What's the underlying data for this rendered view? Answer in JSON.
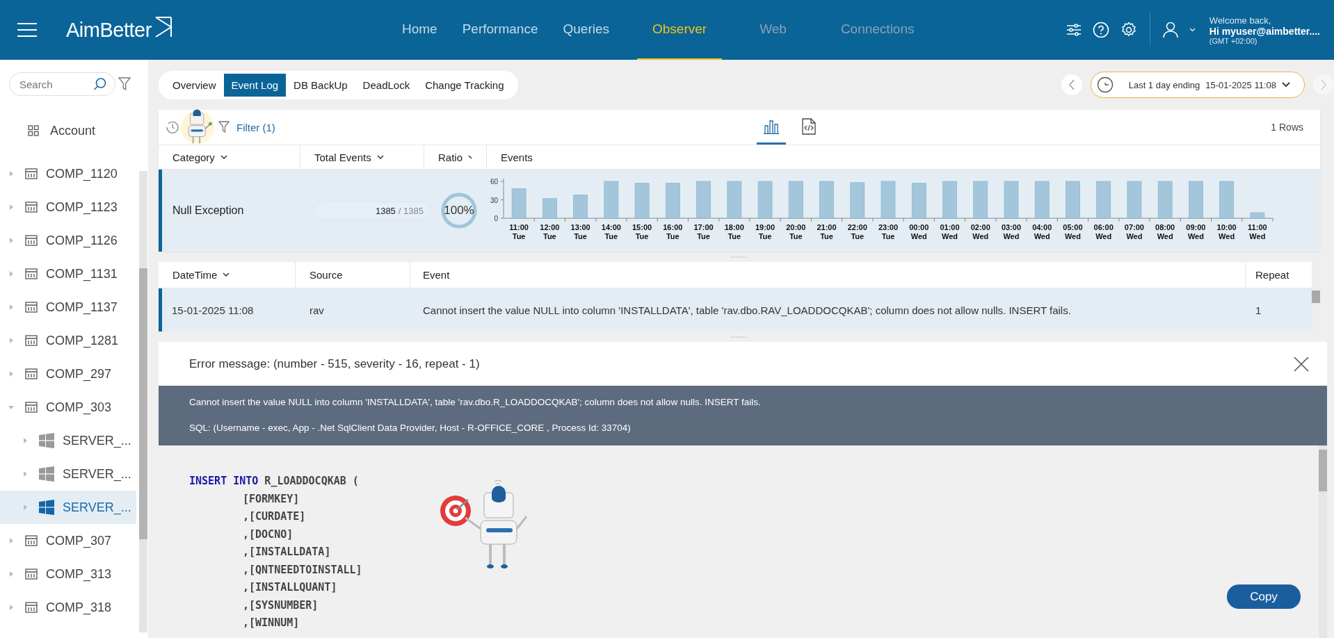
{
  "header": {
    "logo": "AimBetter",
    "nav": [
      {
        "label": "Home",
        "selected": false,
        "disabled": false
      },
      {
        "label": "Performance",
        "selected": false,
        "disabled": false
      },
      {
        "label": "Queries",
        "selected": false,
        "disabled": false
      },
      {
        "label": "Observer",
        "selected": true,
        "disabled": false
      },
      {
        "label": "Web",
        "selected": false,
        "disabled": true
      },
      {
        "label": "Connections",
        "selected": false,
        "disabled": true
      }
    ],
    "user": {
      "greeting": "Welcome back,",
      "name": "Hi myuser@aimbetter....",
      "timezone": "(GMT +02:00)"
    }
  },
  "sidebar": {
    "search": {
      "placeholder": "Search"
    },
    "account": "Account",
    "items": [
      {
        "label": "COMP_1120",
        "expanded": false,
        "selected": false
      },
      {
        "label": "COMP_1123",
        "expanded": false,
        "selected": false
      },
      {
        "label": "COMP_1126",
        "expanded": false,
        "selected": false
      },
      {
        "label": "COMP_1131",
        "expanded": false,
        "selected": false
      },
      {
        "label": "COMP_1137",
        "expanded": false,
        "selected": false
      },
      {
        "label": "COMP_1281",
        "expanded": false,
        "selected": false
      },
      {
        "label": "COMP_297",
        "expanded": false,
        "selected": false
      },
      {
        "label": "COMP_303",
        "expanded": true,
        "selected": false,
        "children": [
          {
            "label": "SERVER_...",
            "selected": false
          },
          {
            "label": "SERVER_...",
            "selected": false
          },
          {
            "label": "SERVER_...",
            "selected": true
          }
        ]
      },
      {
        "label": "COMP_307",
        "expanded": false,
        "selected": false
      },
      {
        "label": "COMP_313",
        "expanded": false,
        "selected": false
      },
      {
        "label": "COMP_318",
        "expanded": false,
        "selected": false
      }
    ]
  },
  "tabs": [
    {
      "label": "Overview",
      "selected": false
    },
    {
      "label": "Event Log",
      "selected": true
    },
    {
      "label": "DB BackUp",
      "selected": false
    },
    {
      "label": "DeadLock",
      "selected": false
    },
    {
      "label": "Change Tracking",
      "selected": false
    }
  ],
  "time_range": {
    "label": "Last 1 day ending",
    "value": "15-01-2025 11:08"
  },
  "events_panel": {
    "filter": "Filter (1)",
    "views": [
      {
        "kind": "chart",
        "selected": true
      },
      {
        "kind": "code",
        "selected": false
      }
    ],
    "row_count": "1 Rows",
    "columns": [
      "Category",
      "Total Events",
      "Ratio",
      "Events"
    ],
    "rows": [
      {
        "category": "Null Exception",
        "count": "1385",
        "total": "/ 1385",
        "level": 1,
        "ratio": "100%",
        "selected": true,
        "chart_data": {
          "type": "bar",
          "categories": [
            "11:00 Tue",
            "12:00 Tue",
            "13:00 Tue",
            "14:00 Tue",
            "15:00 Tue",
            "16:00 Tue",
            "17:00 Tue",
            "18:00 Tue",
            "19:00 Tue",
            "20:00 Tue",
            "21:00 Tue",
            "22:00 Tue",
            "23:00 Tue",
            "00:00 Wed",
            "01:00 Wed",
            "02:00 Wed",
            "03:00 Wed",
            "04:00 Wed",
            "05:00 Wed",
            "06:00 Wed",
            "07:00 Wed",
            "08:00 Wed",
            "09:00 Wed",
            "10:00 Wed",
            "11:00 Wed"
          ],
          "values": [
            48,
            32,
            38,
            60,
            57,
            57,
            60,
            60,
            60,
            60,
            60,
            58,
            60,
            57,
            60,
            60,
            60,
            60,
            60,
            60,
            60,
            60,
            60,
            60,
            9
          ],
          "ylim": [
            0,
            60
          ],
          "yticks": [
            0,
            30,
            60
          ]
        }
      }
    ]
  },
  "event_log": {
    "columns": [
      "DateTime",
      "Source",
      "Event",
      "Repeat"
    ],
    "rows": [
      {
        "datetime": "15-01-2025 11:08",
        "source": "rav",
        "event": "Cannot insert the value NULL into column 'INSTALLDATA', table 'rav.dbo.RAV_LOADDOCQKAB'; column does not allow nulls. INSERT fails.",
        "repeat": "1",
        "selected": true
      }
    ]
  },
  "error": {
    "title": "Error message: (number - 515, severity - 16, repeat - 1)",
    "message": "Cannot insert the value NULL into column 'INSTALLDATA', table 'rav.dbo.R_LOADDOCQKAB'; column does not allow nulls. INSERT fails.",
    "sql": "SQL: (Username - exec, App - .Net SqlClient Data Provider, Host - R-OFFICE_CORE , Process Id: 33704)",
    "code": [
      {
        "kind": "statement",
        "keyword": "INSERT INTO",
        "text": "R_LOADDOCQKAB ("
      },
      {
        "kind": "column",
        "text": "[FORMKEY]"
      },
      {
        "kind": "column",
        "text": ",[CURDATE]"
      },
      {
        "kind": "column",
        "text": ",[DOCNO]"
      },
      {
        "kind": "column",
        "text": ",[INSTALLDATA]"
      },
      {
        "kind": "column",
        "text": ",[QNTNEEDTOINSTALL]"
      },
      {
        "kind": "column",
        "text": ",[INSTALLQUANT]"
      },
      {
        "kind": "column",
        "text": ",[SYSNUMBER]"
      },
      {
        "kind": "column",
        "text": ",[WINNUM]"
      }
    ],
    "copy": "Copy"
  }
}
